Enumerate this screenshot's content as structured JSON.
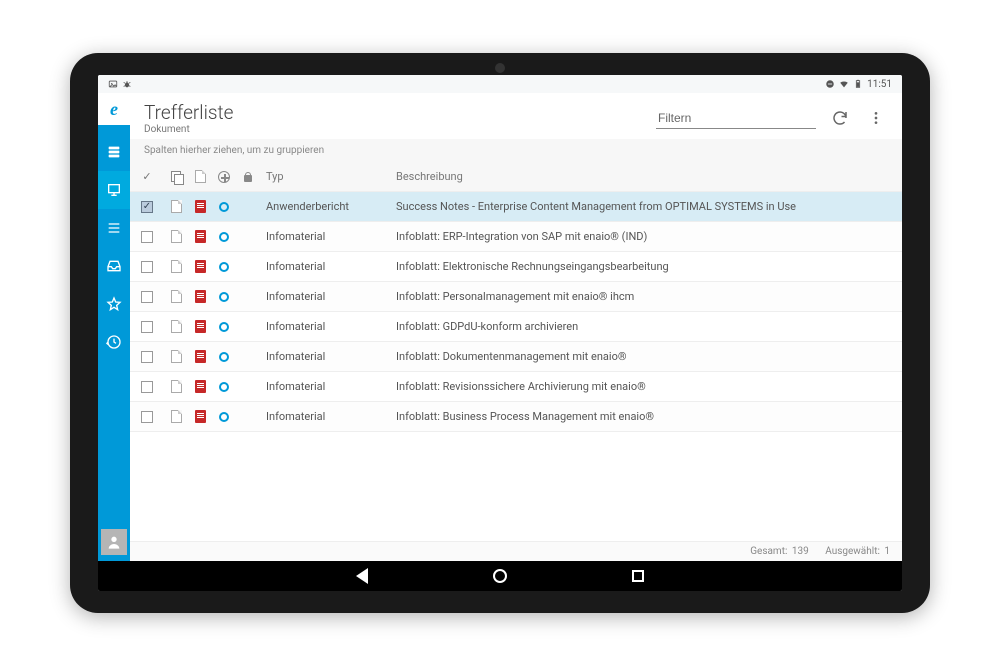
{
  "statusbar": {
    "time": "11:51"
  },
  "header": {
    "title": "Trefferliste",
    "subtitle": "Dokument",
    "filter_placeholder": "Filtern"
  },
  "group_hint": "Spalten hierher ziehen, um zu gruppieren",
  "columns": {
    "typ": "Typ",
    "beschreibung": "Beschreibung"
  },
  "rows": [
    {
      "checked": true,
      "typ": "Anwenderbericht",
      "desc": "Success Notes - Enterprise Content Management from OPTIMAL SYSTEMS in Use"
    },
    {
      "checked": false,
      "typ": "Infomaterial",
      "desc": "Infoblatt: ERP-Integration von SAP mit enaio® (IND)"
    },
    {
      "checked": false,
      "typ": "Infomaterial",
      "desc": "Infoblatt: Elektronische Rechnungseingangsbearbeitung"
    },
    {
      "checked": false,
      "typ": "Infomaterial",
      "desc": "Infoblatt: Personalmanagement mit enaio® ihcm"
    },
    {
      "checked": false,
      "typ": "Infomaterial",
      "desc": "Infoblatt: GDPdU-konform archivieren"
    },
    {
      "checked": false,
      "typ": "Infomaterial",
      "desc": "Infoblatt: Dokumentenmanagement mit enaio®"
    },
    {
      "checked": false,
      "typ": "Infomaterial",
      "desc": "Infoblatt: Revisionssichere Archivierung mit enaio®"
    },
    {
      "checked": false,
      "typ": "Infomaterial",
      "desc": "Infoblatt: Business Process Management mit enaio®"
    }
  ],
  "footer": {
    "total_label": "Gesamt:",
    "total": "139",
    "selected_label": "Ausgewählt:",
    "selected": "1"
  }
}
